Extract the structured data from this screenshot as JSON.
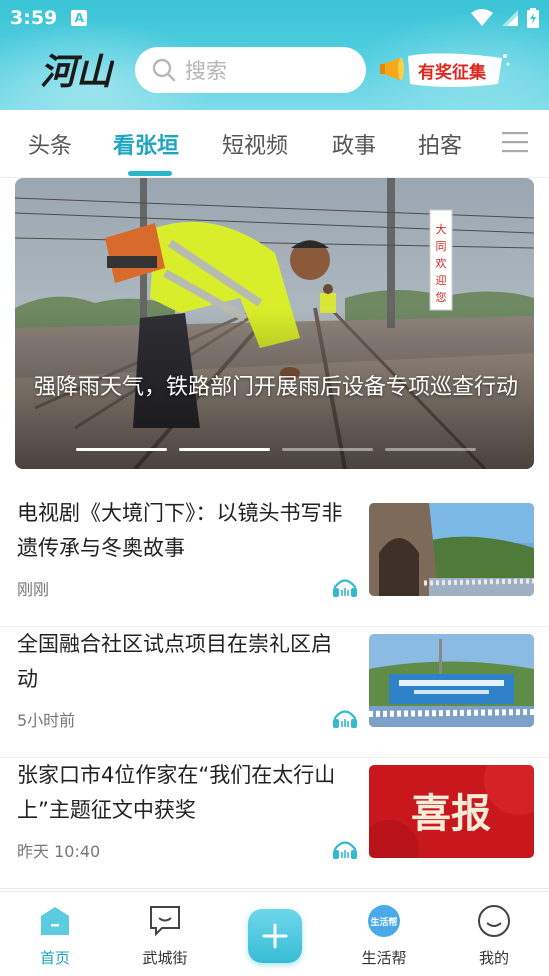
{
  "status_bar": {
    "time": "3:59",
    "notification_glyph": "A"
  },
  "header": {
    "logo_text": "河山",
    "search_placeholder": "搜索",
    "promo_text": "有奖征集"
  },
  "tabs": [
    {
      "label": "头条",
      "active": false
    },
    {
      "label": "看张垣",
      "active": true
    },
    {
      "label": "短视频",
      "active": false
    },
    {
      "label": "政事",
      "active": false
    },
    {
      "label": "拍客",
      "active": false
    }
  ],
  "banner": {
    "title": "强降雨天气，铁路部门开展雨后设备专项巡查行动",
    "sign_text": "大同欢迎您",
    "slide_count": 4,
    "active_slide": 1
  },
  "news": [
    {
      "title": "电视剧《大境门下》：以镜头书写非遗传承与冬奥故事",
      "time": "刚刚",
      "thumb": "great-wall-gate-photo"
    },
    {
      "title": "全国融合社区试点项目在崇礼区启动",
      "time": "5小时前",
      "thumb": "community-event-photo"
    },
    {
      "title": "张家口市4位作家在“我们在太行山上”主题征文中获奖",
      "time": "昨天  10:40",
      "thumb": "good-news-banner",
      "thumb_text": "喜报"
    }
  ],
  "bottom_nav": [
    {
      "label": "首页",
      "icon": "home-icon",
      "active": true
    },
    {
      "label": "武城街",
      "icon": "chat-icon",
      "active": false
    },
    {
      "label": "",
      "icon": "plus-icon",
      "active": false
    },
    {
      "label": "生活帮",
      "icon": "life-help-icon",
      "active": false,
      "icon_text": "生活帮"
    },
    {
      "label": "我的",
      "icon": "profile-icon",
      "active": false
    }
  ],
  "colors": {
    "accent": "#29b6cc",
    "header_top": "#39c3d6",
    "header_bottom": "#7fdce9",
    "active_text": "#1fa5c1"
  }
}
